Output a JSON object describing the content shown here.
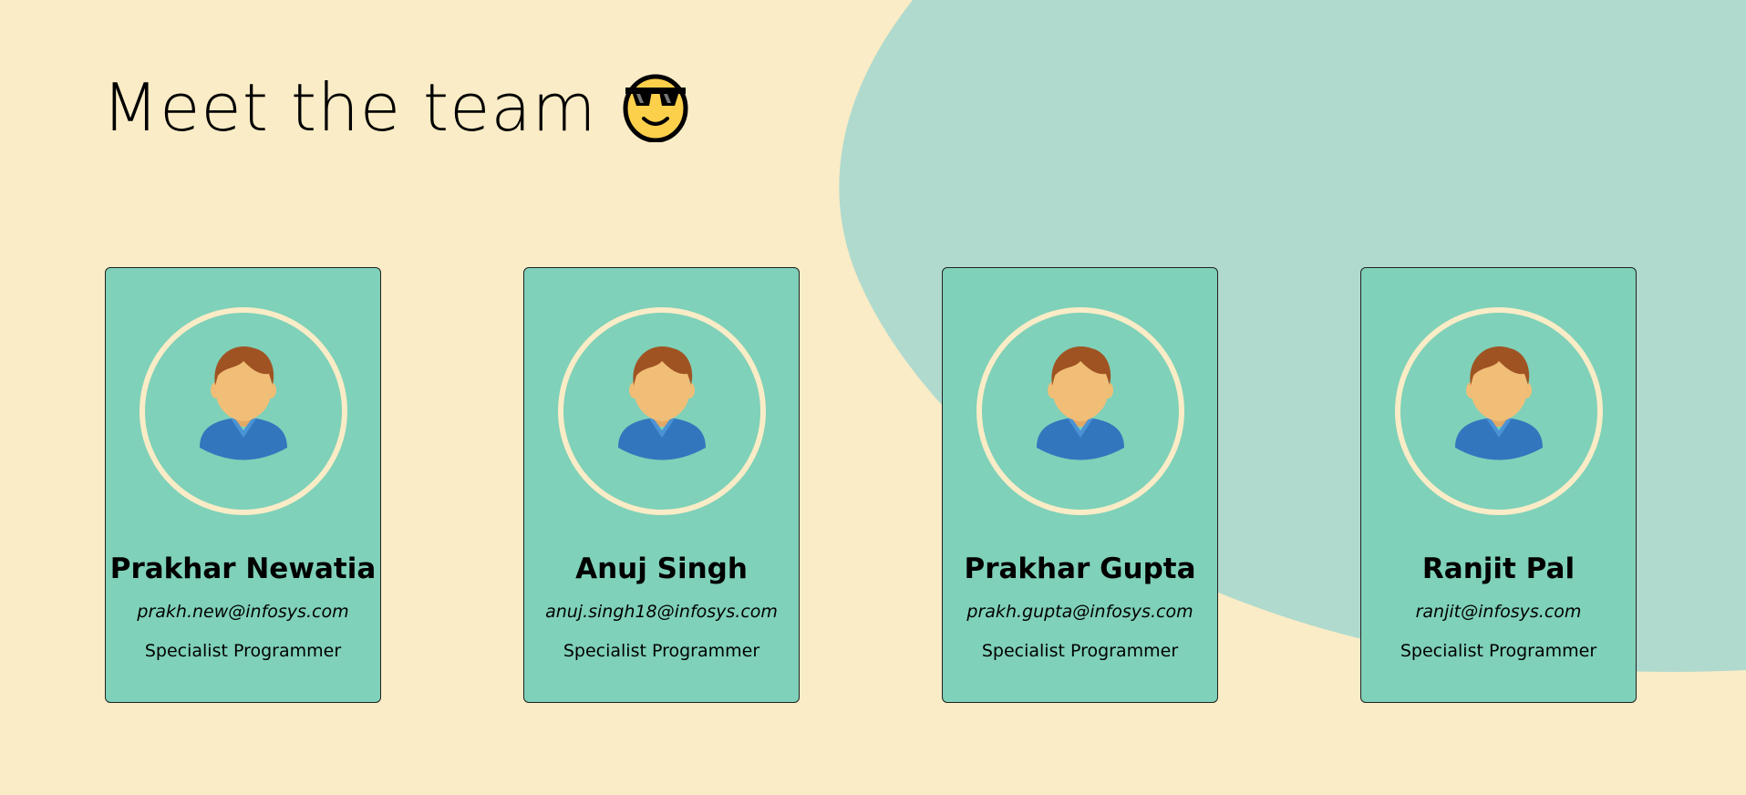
{
  "header": {
    "title": "Meet the team",
    "emoji_icon": "sunglasses-face-icon"
  },
  "colors": {
    "background": "#faecc6",
    "blob": "#b0dace",
    "card": "#7fd1b9"
  },
  "team": [
    {
      "name": "Prakhar Newatia",
      "email": "prakh.new@infosys.com",
      "role": "Specialist Programmer"
    },
    {
      "name": "Anuj Singh",
      "email": "anuj.singh18@infosys.com",
      "role": "Specialist Programmer"
    },
    {
      "name": "Prakhar Gupta",
      "email": "prakh.gupta@infosys.com",
      "role": "Specialist Programmer"
    },
    {
      "name": "Ranjit Pal",
      "email": "ranjit@infosys.com",
      "role": "Specialist Programmer"
    }
  ]
}
